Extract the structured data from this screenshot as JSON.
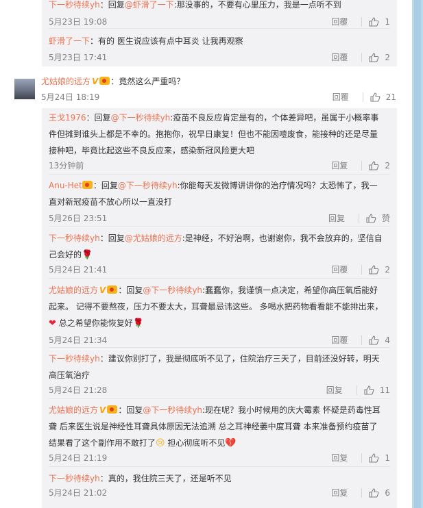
{
  "top_thread": [
    {
      "user": "下一秒待续yh",
      "text_prefix": "：回复",
      "at": "@虾滑了一下",
      "text": ":那没事的，不要有心里压力，我是一点听不到",
      "time": "5月23日 19:08",
      "reply_label": "回覆",
      "likes": "1"
    },
    {
      "user": "虾滑了一下",
      "text": "：有的 医生说应该有点中耳炎 让我再观察",
      "time": "5月23日 17:41",
      "reply_label": "回覆",
      "likes": "2"
    }
  ],
  "main_comment": {
    "user": "尤姑娘的远方",
    "vip_badge": "V",
    "text": "：竟然这么严重吗？",
    "time": "5月24日 18:19",
    "reply_label": "回覆",
    "likes": "21"
  },
  "replies": [
    {
      "user": "王戈1976",
      "text_prefix": "：回复",
      "at": "@下一秒待续yh",
      "text": ":疫苗不良反应肯定是有的，个体差异吧，虽属于小概率事件但摊到谁头上都是不幸的。抱抱你，祝早日康复！但也不能因噎废食，能接种的还是尽量接种吧，毕竟比起这些不良反应来，感染新冠风险更大吧",
      "time": "13分钟前",
      "reply_label": "回复",
      "likes": "2"
    },
    {
      "user": "Anu-Het",
      "text_prefix": "：回复",
      "at": "@下一秒待续yh",
      "text": ":你能每天发微博讲讲你的治疗情况吗？太恐怖了，我一直对新冠疫苗不放心所以一直没打",
      "time": "5月26日 23:51",
      "reply_label": "回复",
      "likes": "赞"
    },
    {
      "user": "下一秒待续yh",
      "text_prefix": "：回复",
      "at": "@尤姑娘的远方",
      "text": ":是神经，不好治啊，也谢谢你，我不会放弃的，坚信自己会好的",
      "time": "5月24日 21:41",
      "reply_label": "回覆",
      "likes": "2"
    },
    {
      "user": "尤姑娘的远方",
      "vip_badge": "V",
      "text_prefix": "：回复",
      "at": "@下一秒待续yh",
      "text": ":蠢蠢你，我谨慎一点决定，希望你高压氧后能好起来。 记得不要熬夜，压力不要太大，耳聋最忌讳这些。 多喝水把药物看看能不能排出来，",
      "text2": " 总之希望你能恢复好",
      "time": "5月24日 21:34",
      "reply_label": "回覆",
      "likes": "4"
    },
    {
      "user": "下一秒待续yh",
      "text": "：建议你别打了，我是彻底听不见了，住院治疗三天了，目前还没好转，明天高压氧治疗",
      "time": "5月24日 21:28",
      "reply_label": "回复",
      "likes": "11"
    },
    {
      "user": "尤姑娘的远方",
      "vip_badge": "V",
      "text_prefix": "：回复",
      "at": "@下一秒待续yh",
      "text": ":现在呢？我小时候用的庆大霉素 怀疑是药毒性耳聋 后来医生说是神经性耳聋具体原因无法追溯 总之耳神经萎中度耳聋 本来准备预约疫苗了 结果看了这个副作用不敢打了",
      "text2": " 担心彻底听不见",
      "time": "5月24日 21:19",
      "reply_label": "回复",
      "likes": "1"
    },
    {
      "user": "下一秒待续yh",
      "text": "：真的，我住院三天了，还是听不见",
      "time": "5月24日 21:02",
      "reply_label": "回复",
      "likes": "6"
    }
  ]
}
